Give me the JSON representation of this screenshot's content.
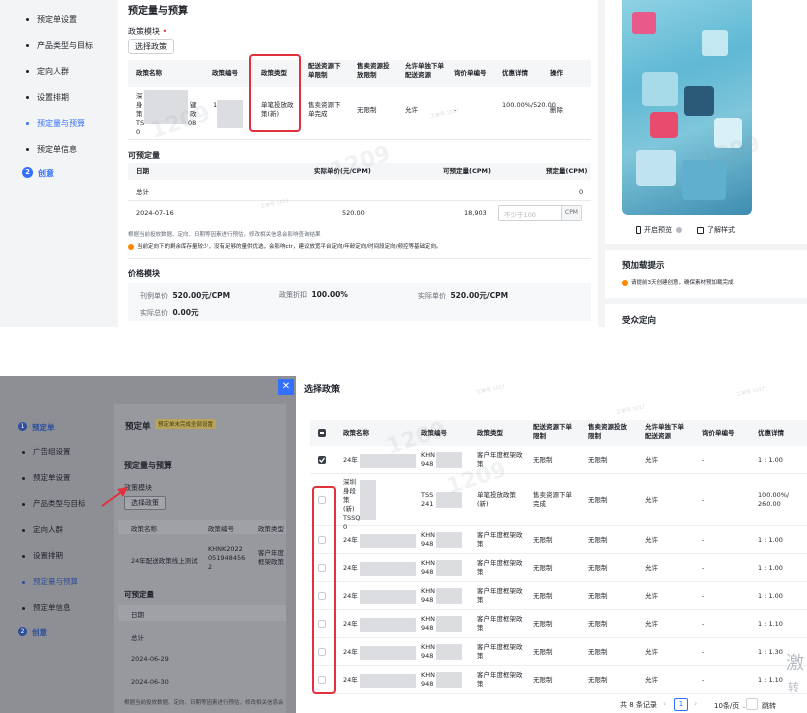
{
  "top": {
    "sidebar": [
      {
        "label": "预定单设置",
        "active": false
      },
      {
        "label": "产品类型与目标",
        "active": false
      },
      {
        "label": "定向人群",
        "active": false
      },
      {
        "label": "设置排期",
        "active": false
      },
      {
        "label": "预定量与预算",
        "active": true
      },
      {
        "label": "预定单信息",
        "active": false
      }
    ],
    "step2": {
      "num": "2",
      "label": "创意"
    },
    "section_title": "预定量与预算",
    "policy_module": "政策模块",
    "required_star": "•",
    "select_button": "选择政策",
    "policy_headers": [
      "政策名称",
      "政策编号",
      "政策类型",
      "配送资源下单限制",
      "售卖资源投放限制",
      "允许单独下单配送资源",
      "询价单编号",
      "优惠详情",
      "操作"
    ],
    "policy_row": {
      "name_lines": [
        "深",
        "身",
        "策",
        "TS",
        "0"
      ],
      "name_lines_b": [
        "键",
        "",
        "政",
        "08",
        ""
      ],
      "id_lines": [
        "1",
        "",
        "",
        "",
        ""
      ],
      "type": "单笔投放政策(新)",
      "limit": "售卖资源下单完成",
      "sell_limit": "无限制",
      "allow": "允许",
      "inquiry": "-",
      "discount": "100.00%/520.00",
      "op": "删除"
    },
    "avail_title": "可预定量",
    "avail_headers": [
      "日期",
      "实际单价(元/CPM)",
      "可预定量(CPM)",
      "预定量(CPM)"
    ],
    "total_label": "总计",
    "total_value": "0",
    "row_date": "2024-07-16",
    "row_price": "520.00",
    "row_avail": "18,903",
    "row_input_placeholder": "不少于100",
    "row_unit": "CPM",
    "note1": "根据当前投放数据、定向、日期等因素进行预估，修改相关信息会影响查询结果",
    "note2": "当前定向下的剩余库存量较少，没有足够的量供优选，会影响ctr，建议放宽平台定向/年龄定向/时间段定向/频控等基础定向。",
    "price_title": "价格模块",
    "list_price_label": "刊例单价",
    "list_price_value": "520.00元/CPM",
    "discount_label": "政策折扣",
    "discount_value": "100.00%",
    "real_price_label": "实际单价",
    "real_price_value": "520.00元/CPM",
    "total_price_label": "实际总价",
    "total_price_value": "0.00元",
    "preview_btn": "开启预览",
    "style_btn": "了解样式",
    "tip_title": "预加载提示",
    "tip_text": "请提前3天创建创意，确保素材预加载完成",
    "audience_title": "受众定向"
  },
  "bottom_left": {
    "step1": {
      "num": "1",
      "label": "预定单"
    },
    "sidebar": [
      "广告组设置",
      "预定单设置",
      "产品类型与目标",
      "定向人群",
      "设置排期",
      "预定量与预算",
      "预定单信息"
    ],
    "step2": {
      "num": "2",
      "label": "创意"
    },
    "page_title": "预定单",
    "badge": "预定单未完成全部设置",
    "section_title": "预定量与预算",
    "policy_module": "政策模块",
    "select_button": "选择政策",
    "headers": [
      "政策名称",
      "政策编号",
      "政策类型"
    ],
    "row": {
      "name": "24年配送政策线上测试",
      "id": "KHNK2022 0519484562",
      "type": "客户年度框架政策"
    },
    "avail_title": "可预定量",
    "col_date": "日期",
    "total_label": "总计",
    "dates": [
      "2024-06-29",
      "2024-06-30"
    ],
    "note": "根据当前投放数据、定向、日期等因素进行预估，修改相关信息会"
  },
  "modal": {
    "title": "选择政策",
    "headers": [
      "政策名称",
      "政策编号",
      "政策类型",
      "配送资源下单限制",
      "售卖资源投放限制",
      "允许单独下单配送资源",
      "询价单编号",
      "优惠详情"
    ],
    "rows": [
      {
        "name": "24年",
        "id": "KHN 948",
        "type": "客户年度框架政策",
        "limit": "无限制",
        "sell": "无限制",
        "allow": "允许",
        "inquiry": "-",
        "discount": "1 : 1.00",
        "checked": true
      },
      {
        "name": "深圳 身段 策(新) TSSQ 0",
        "id": "TSS 241",
        "type": "单笔投放政策(新)",
        "limit": "售卖资源下单完成",
        "sell": "无限制",
        "allow": "允许",
        "inquiry": "-",
        "discount": "100.00%/ 260.00",
        "checked": false
      },
      {
        "name": "24年",
        "id": "KHN 948",
        "type": "客户年度框架政策",
        "limit": "无限制",
        "sell": "无限制",
        "allow": "允许",
        "inquiry": "-",
        "discount": "1 : 1.00",
        "checked": false
      },
      {
        "name": "24年",
        "id": "KHN 948",
        "type": "客户年度框架政策",
        "limit": "无限制",
        "sell": "无限制",
        "allow": "允许",
        "inquiry": "-",
        "discount": "1 : 1.00",
        "checked": false
      },
      {
        "name": "24年",
        "id": "KHN 948",
        "type": "客户年度框架政策",
        "limit": "无限制",
        "sell": "无限制",
        "allow": "允许",
        "inquiry": "-",
        "discount": "1 : 1.00",
        "checked": false
      },
      {
        "name": "24年",
        "id": "KHN 948",
        "type": "客户年度框架政策",
        "limit": "无限制",
        "sell": "无限制",
        "allow": "允许",
        "inquiry": "-",
        "discount": "1 : 1.10",
        "checked": false
      },
      {
        "name": "24年",
        "id": "KHN 948",
        "type": "客户年度框架政策",
        "limit": "无限制",
        "sell": "无限制",
        "allow": "允许",
        "inquiry": "-",
        "discount": "1 : 1.30",
        "checked": false
      },
      {
        "name": "24年",
        "id": "KHN 948",
        "type": "客户年度框架政策",
        "limit": "无限制",
        "sell": "无限制",
        "allow": "允许",
        "inquiry": "-",
        "discount": "1 : 1.10",
        "checked": false
      }
    ],
    "pagination": {
      "total": "共 8 条记录",
      "page": "1",
      "size": "10条/页",
      "jump": "跳转"
    },
    "corner_text_1": "激",
    "corner_text_2": "转"
  },
  "watermark": "1209",
  "watermark_small": "工单号 1017",
  "colors": {
    "accent": "#3370ff",
    "danger": "#e0313c",
    "warning": "#ff8800"
  }
}
